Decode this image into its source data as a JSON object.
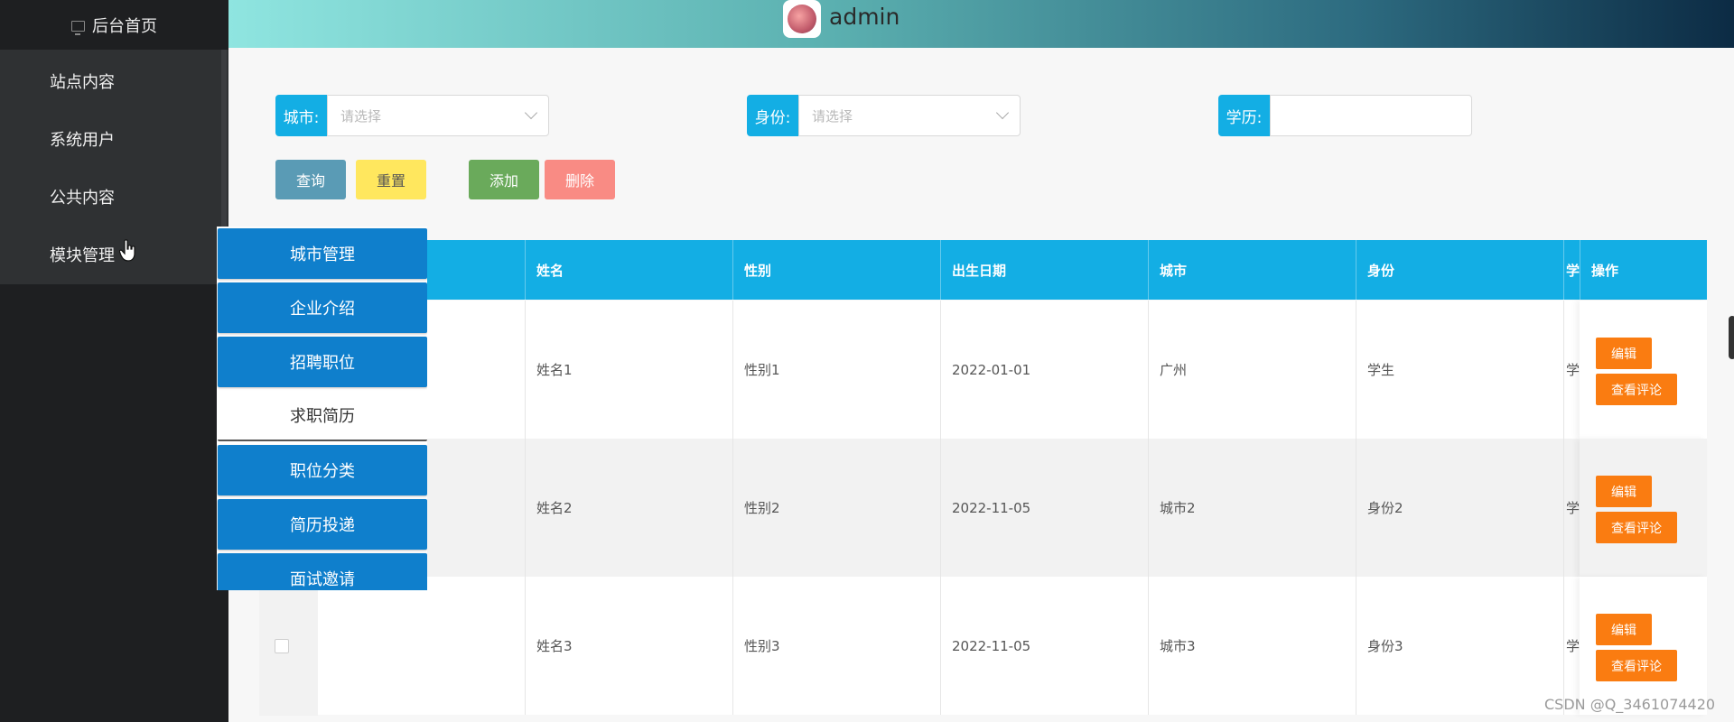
{
  "sidebar": {
    "home_label": "后台首页",
    "items": [
      {
        "label": "站点内容"
      },
      {
        "label": "系统用户"
      },
      {
        "label": "公共内容"
      },
      {
        "label": "模块管理"
      }
    ]
  },
  "header": {
    "username": "admin"
  },
  "search": {
    "city_label": "城市:",
    "city_placeholder": "请选择",
    "identity_label": "身份:",
    "identity_placeholder": "请选择",
    "education_label": "学历:"
  },
  "toolbar": {
    "query_label": "查询",
    "reset_label": "重置",
    "add_label": "添加",
    "delete_label": "删除"
  },
  "table": {
    "columns": [
      "姓名",
      "性别",
      "出生日期",
      "城市",
      "身份",
      "学",
      "操作"
    ],
    "rows": [
      {
        "name": "姓名1",
        "gender": "性别1",
        "birth": "2022-01-01",
        "city": "广州",
        "identity": "学生",
        "edu": "学"
      },
      {
        "name": "姓名2",
        "gender": "性别2",
        "birth": "2022-11-05",
        "city": "城市2",
        "identity": "身份2",
        "edu": "学"
      },
      {
        "name": "姓名3",
        "gender": "性别3",
        "birth": "2022-11-05",
        "city": "城市3",
        "identity": "身份3",
        "edu": "学"
      }
    ],
    "edit_label": "编辑",
    "comments_label": "查看评论"
  },
  "dropdown": {
    "items": [
      {
        "label": "城市管理"
      },
      {
        "label": "企业介绍"
      },
      {
        "label": "招聘职位"
      },
      {
        "label": "求职简历"
      },
      {
        "label": "职位分类"
      },
      {
        "label": "简历投递"
      },
      {
        "label": "面试邀请"
      }
    ]
  },
  "watermark": "CSDN @Q_3461074420",
  "colors": {
    "accent": "#13aee4",
    "dropdown": "#0f7fcc",
    "sidebar": "#1e1f21",
    "query_btn": "#5a9bb5",
    "reset_btn": "#ffe75e",
    "add_btn": "#6aaa5b",
    "delete_btn": "#f98b84",
    "op_btn": "#fa7c11"
  }
}
